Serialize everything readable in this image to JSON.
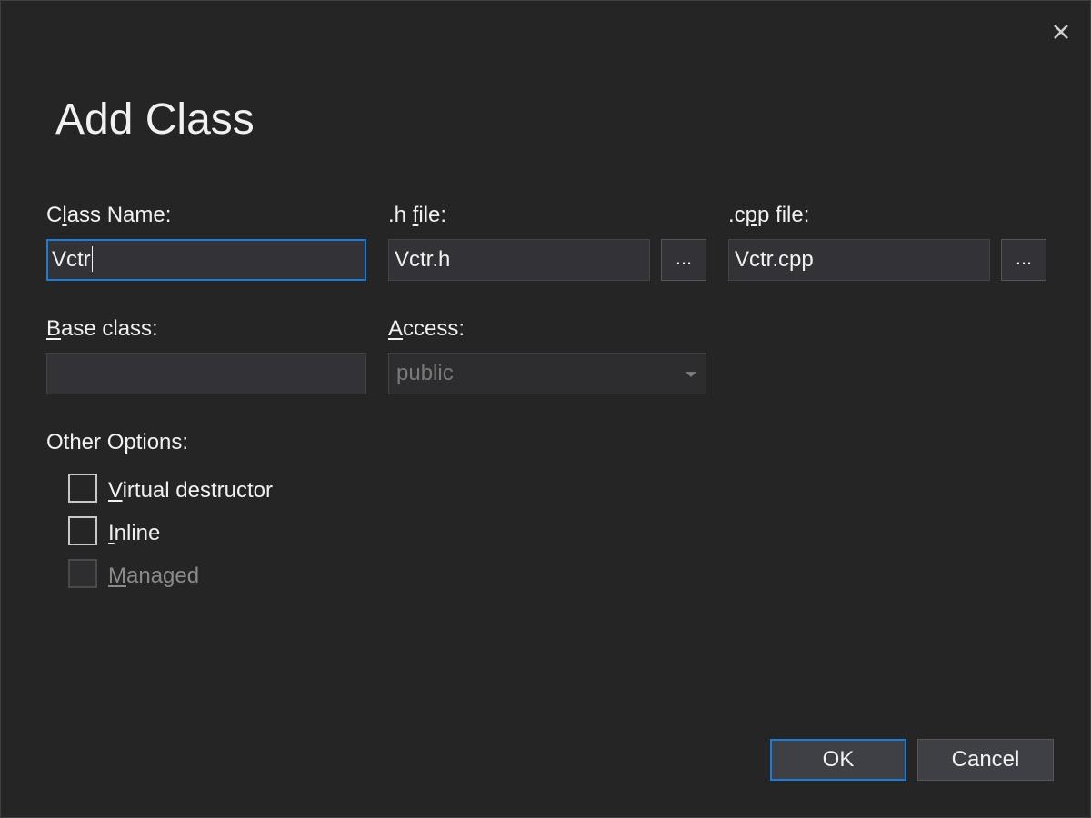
{
  "dialog": {
    "title": "Add Class",
    "close_icon": "close-icon"
  },
  "fields": {
    "class_name": {
      "label_pre": "C",
      "label_ul": "l",
      "label_post": "ass Name:",
      "value": "Vctr"
    },
    "h_file": {
      "label_pre": ".h ",
      "label_ul": "f",
      "label_post": "ile:",
      "value": "Vctr.h",
      "browse_label": "..."
    },
    "cpp_file": {
      "label_pre": ".c",
      "label_ul": "p",
      "label_post": "p file:",
      "value": "Vctr.cpp",
      "browse_label": "..."
    },
    "base_class": {
      "label_pre": "",
      "label_ul": "B",
      "label_post": "ase class:",
      "value": ""
    },
    "access": {
      "label_pre": "",
      "label_ul": "A",
      "label_post": "ccess:",
      "selected": "public"
    }
  },
  "options": {
    "heading": "Other Options:",
    "items": [
      {
        "label_ul": "V",
        "label_post": "irtual destructor",
        "checked": false,
        "enabled": true
      },
      {
        "label_ul": "I",
        "label_post": "nline",
        "checked": false,
        "enabled": true
      },
      {
        "label_ul": "M",
        "label_post": "anaged",
        "checked": false,
        "enabled": false
      }
    ]
  },
  "buttons": {
    "ok": "OK",
    "cancel": "Cancel"
  },
  "colors": {
    "background": "#252526",
    "accent": "#1c7cd6",
    "text": "#f1f1f1",
    "disabled_text": "#8a8a8a"
  }
}
